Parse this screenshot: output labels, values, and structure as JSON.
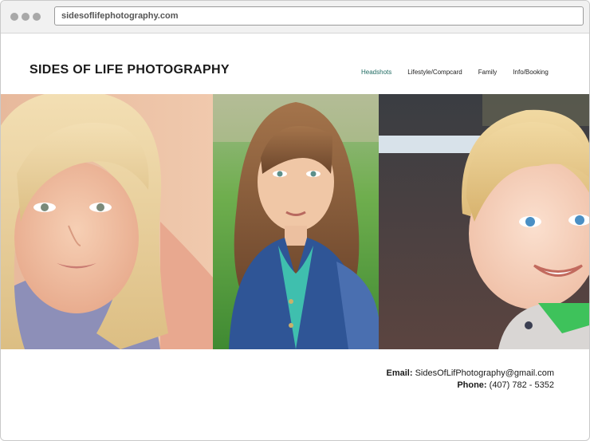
{
  "browser": {
    "url": "sidesoflifephotography.com"
  },
  "site": {
    "title": "SIDES OF LIFE PHOTOGRAPHY"
  },
  "nav": {
    "items": [
      {
        "label": "Headshots",
        "active": true
      },
      {
        "label": "Lifestyle/Compcard",
        "active": false
      },
      {
        "label": "Family",
        "active": false
      },
      {
        "label": "Info/Booking",
        "active": false
      }
    ],
    "active_color": "#1f6b62"
  },
  "gallery": {
    "photos": [
      {
        "subject": "blonde girl headshot with pink background"
      },
      {
        "subject": "girl in denim jacket with green background"
      },
      {
        "subject": "smiling curly-haired boy"
      }
    ]
  },
  "contact": {
    "email_label": "Email:",
    "email_value": "SidesOfLifPhotography@gmail.com",
    "phone_label": "Phone:",
    "phone_value": "(407) 782 - 5352"
  }
}
